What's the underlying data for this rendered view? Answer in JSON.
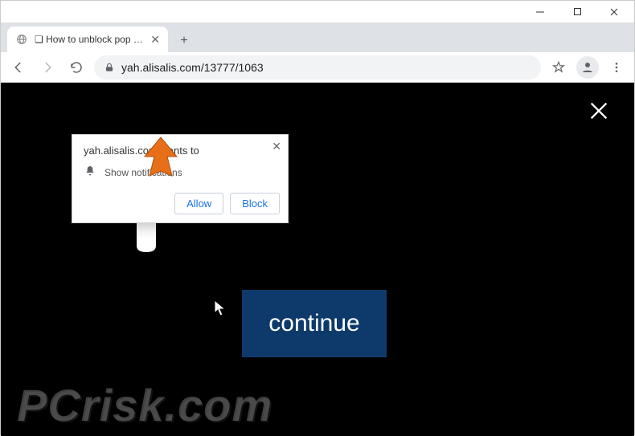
{
  "window": {
    "minimize": "—",
    "maximize": "▢",
    "close": "✕"
  },
  "tab": {
    "title": "❏ How to unblock pop up windo",
    "close": "✕",
    "newtab": "+"
  },
  "toolbar": {
    "url": "yah.alisalis.com/13777/1063"
  },
  "popup": {
    "origin": "yah.alisalis.com wants to",
    "row_label": "Show notifications",
    "close": "✕",
    "allow": "Allow",
    "block": "Block"
  },
  "page": {
    "close": "✕",
    "continue": "continue"
  },
  "watermark": "PCrisk.com"
}
